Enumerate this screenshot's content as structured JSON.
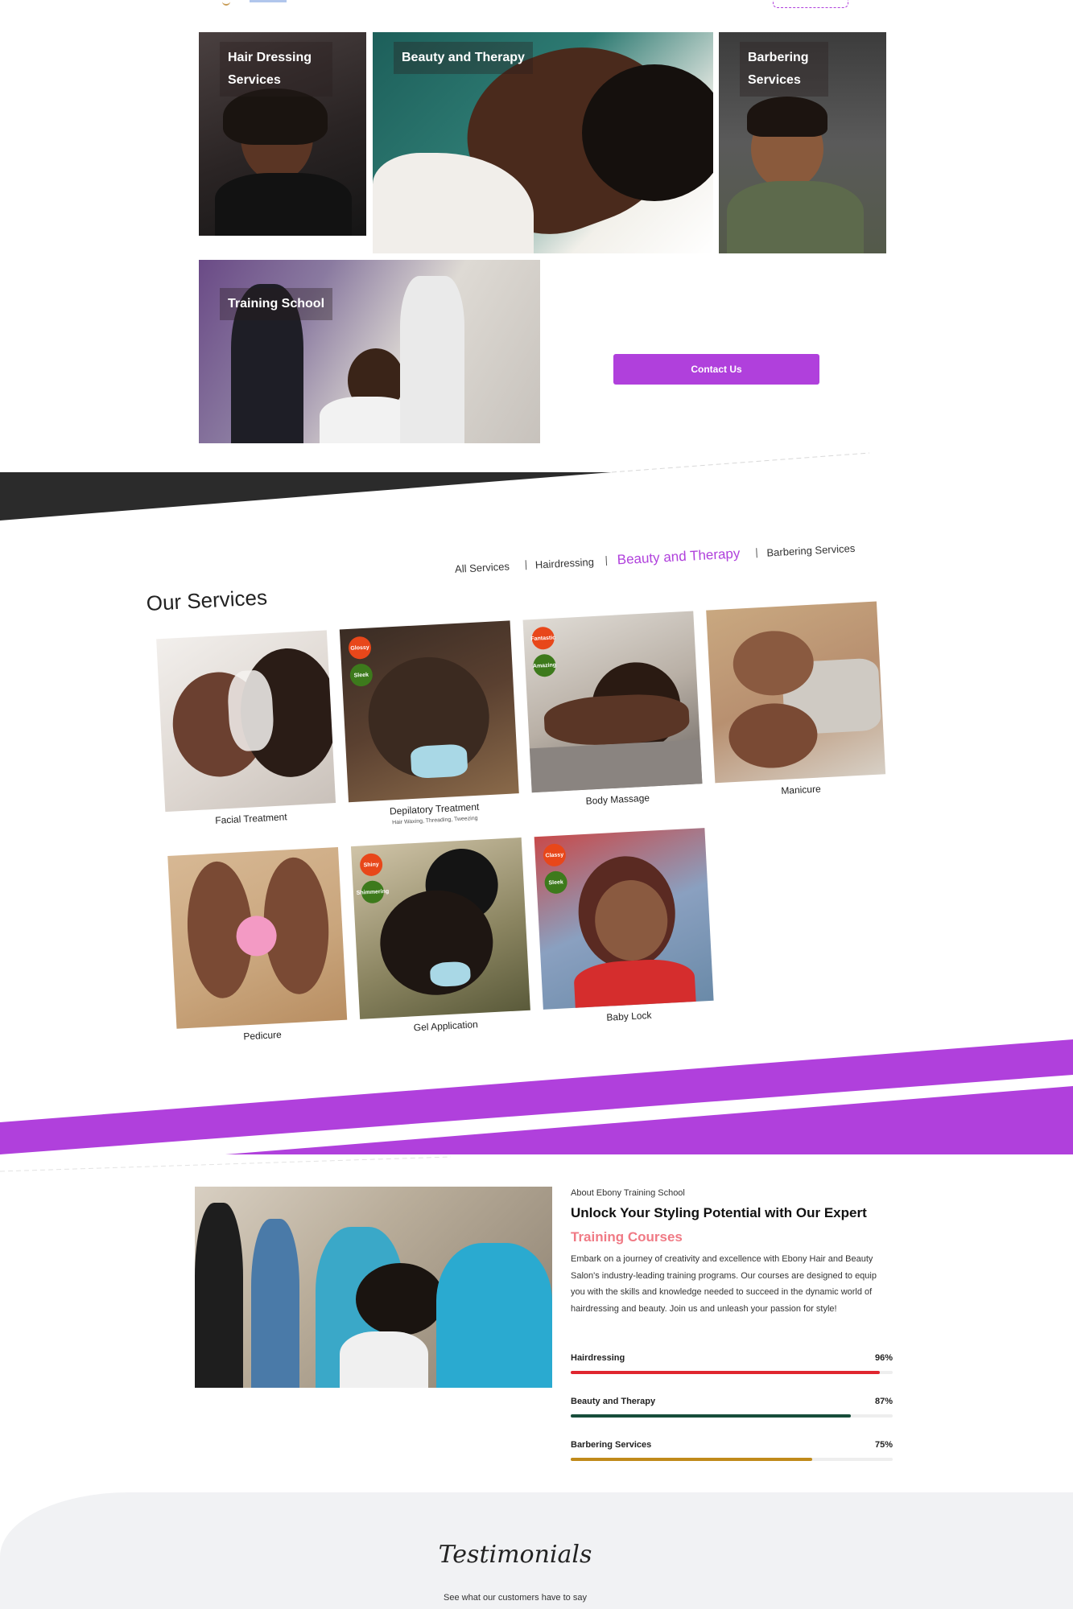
{
  "header": {
    "logo_icon": "scissors-logo-icon"
  },
  "categories": [
    {
      "label": "Hair Dressing Services"
    },
    {
      "label": "Beauty and Therapy"
    },
    {
      "label": "Barbering Services"
    },
    {
      "label": "Training School"
    }
  ],
  "contact_button": "Contact Us",
  "services": {
    "heading": "Our Services",
    "tabs": [
      "All Services",
      "Hairdressing",
      "Beauty and Therapy",
      "Barbering Services"
    ],
    "active_tab": "Beauty and Therapy",
    "items": [
      {
        "name": "Facial Treatment",
        "sub": "",
        "badges": []
      },
      {
        "name": "Depilatory Treatment",
        "sub": "Hair Waxing, Threading, Tweezing",
        "badges": [
          "Glossy",
          "Sleek"
        ]
      },
      {
        "name": "Body Massage",
        "sub": "",
        "badges": [
          "Fantastic",
          "Amazing"
        ]
      },
      {
        "name": "Manicure",
        "sub": "",
        "badges": []
      },
      {
        "name": "Pedicure",
        "sub": "",
        "badges": []
      },
      {
        "name": "Gel Application",
        "sub": "",
        "badges": [
          "Shiny",
          "Shimmering"
        ]
      },
      {
        "name": "Baby Lock",
        "sub": "",
        "badges": [
          "Classy",
          "Sleek"
        ]
      }
    ]
  },
  "about": {
    "kicker": "About Ebony Training School",
    "title": "Unlock Your Styling Potential with Our Expert",
    "highlight": "Training Courses",
    "body": "Embark on a journey of creativity and excellence with Ebony Hair and Beauty Salon's industry-leading training programs. Our courses are designed to equip you with the skills and knowledge needed to succeed in the dynamic world of hairdressing and beauty. Join us and unleash your passion for style!",
    "skills": [
      {
        "label": "Hairdressing",
        "percent_text": "96%",
        "value": 96,
        "color": "#e0262f"
      },
      {
        "label": "Beauty and Therapy",
        "percent_text": "87%",
        "value": 87,
        "color": "#174d3a"
      },
      {
        "label": "Barbering Services",
        "percent_text": "75%",
        "value": 75,
        "color": "#c08a1a"
      }
    ]
  },
  "testimonials": {
    "title": "Testimonials",
    "subtitle": "See what our customers have to say"
  },
  "colors": {
    "accent": "#b040dc",
    "dark_band": "#2b2b2b",
    "highlight": "#f07a85"
  }
}
